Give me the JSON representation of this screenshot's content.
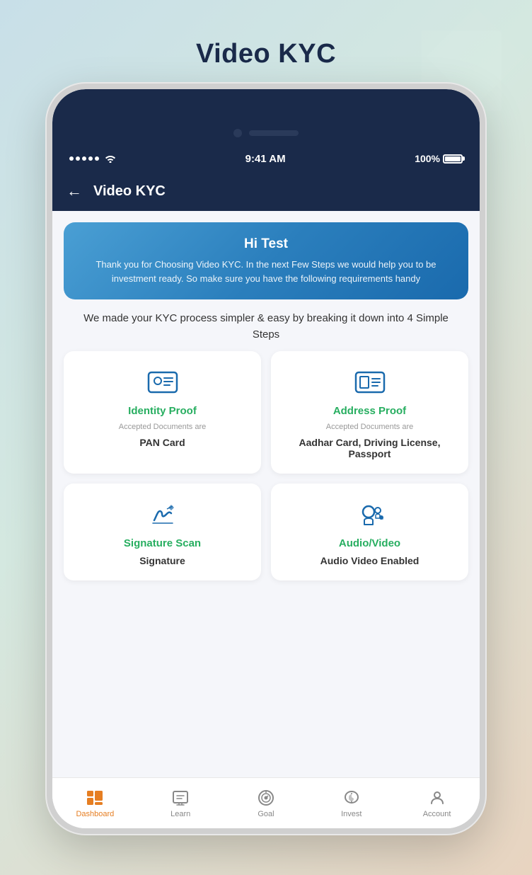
{
  "page": {
    "title": "Video KYC",
    "background_shapes": true
  },
  "status_bar": {
    "time": "9:41 AM",
    "battery": "100%",
    "signal": "•••••"
  },
  "nav": {
    "back_label": "←",
    "title": "Video KYC"
  },
  "banner": {
    "greeting": "Hi Test",
    "subtitle": "Thank you for Choosing Video KYC. In the next Few Steps we would help you to be investment ready. So make sure you have the following requirements handy"
  },
  "steps_text": "We made your KYC process simpler & easy by breaking it down into 4 Simple Steps",
  "cards": [
    {
      "id": "identity",
      "title": "Identity Proof",
      "sub_label": "Accepted Documents are",
      "doc": "PAN Card"
    },
    {
      "id": "address",
      "title": "Address Proof",
      "sub_label": "Accepted Documents are",
      "doc": "Aadhar Card, Driving License, Passport"
    },
    {
      "id": "signature",
      "title": "Signature Scan",
      "sub_label": "",
      "doc": "Signature"
    },
    {
      "id": "audio",
      "title": "Audio/Video",
      "sub_label": "",
      "doc": "Audio Video Enabled"
    }
  ],
  "bottom_nav": {
    "items": [
      {
        "id": "dashboard",
        "label": "Dashboard",
        "active": true
      },
      {
        "id": "learn",
        "label": "Learn",
        "active": false
      },
      {
        "id": "goal",
        "label": "Goal",
        "active": false
      },
      {
        "id": "invest",
        "label": "Invest",
        "active": false
      },
      {
        "id": "account",
        "label": "Account",
        "active": false
      }
    ]
  }
}
